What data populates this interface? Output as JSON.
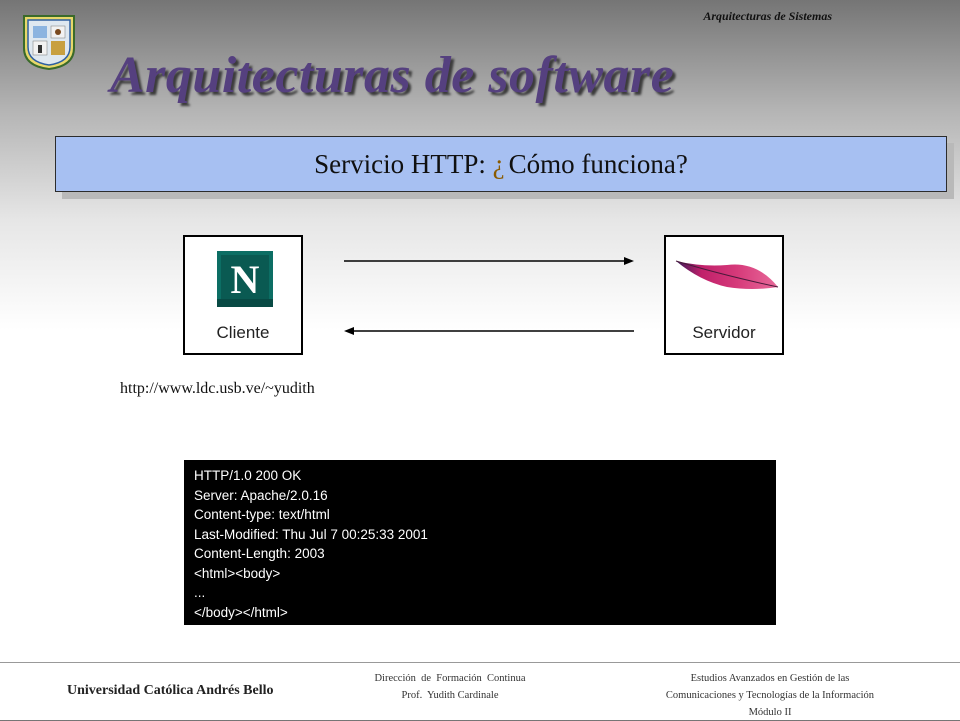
{
  "header": {
    "course": "Arquitecturas de Sistemas",
    "title": "Arquitecturas de software",
    "subtitle_question_mark": "¿",
    "subtitle_prefix": "Servicio HTTP: ",
    "subtitle_suffix": "Cómo funciona?"
  },
  "diagram": {
    "client_label": "Cliente",
    "server_label": "Servidor",
    "client_icon": "netscape-n-icon",
    "server_icon": "apache-feather-icon",
    "url": "http://www.ldc.usb.ve/~yudith"
  },
  "response": {
    "lines": [
      "HTTP/1.0 200 OK",
      "Server: Apache/2.0.16",
      "Content-type: text/html",
      "Last-Modified: Thu Jul 7 00:25:33 2001",
      "Content-Length: 2003",
      "<html><body>",
      "...",
      "</body></html>"
    ]
  },
  "footer": {
    "university": "Universidad Católica Andrés Bello",
    "mid_line1": "Dirección  de  Formación  Continua",
    "mid_line2": "Prof.  Yudith Cardinale",
    "right_line1": "Estudios Avanzados en Gestión  de las",
    "right_line2": "Comunicaciones  y Tecnologías  de la Información",
    "right_line3": "Módulo II"
  },
  "colors": {
    "title": "#55407f",
    "subtitle_bg": "#a7c0f2",
    "response_bg": "#000000"
  }
}
